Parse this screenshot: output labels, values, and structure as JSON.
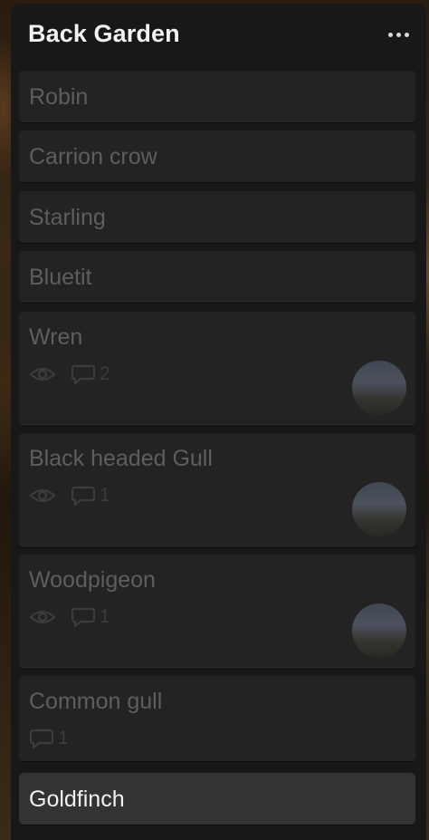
{
  "list": {
    "title": "Back Garden",
    "menu_icon": "more-horizontal-icon"
  },
  "cards": [
    {
      "title": "Robin"
    },
    {
      "title": "Carrion crow"
    },
    {
      "title": "Starling"
    },
    {
      "title": "Bluetit"
    },
    {
      "title": "Wren",
      "watching": true,
      "comments": "2",
      "has_avatar": true
    },
    {
      "title": "Black headed Gull",
      "watching": true,
      "comments": "1",
      "has_avatar": true
    },
    {
      "title": "Woodpigeon",
      "watching": true,
      "comments": "1",
      "has_avatar": true
    },
    {
      "title": "Common gull",
      "watching": false,
      "comments": "1",
      "has_avatar": false
    },
    {
      "title": "Goldfinch",
      "selected": true
    }
  ],
  "colors": {
    "list_bg": "#181818",
    "card_bg": "#232323",
    "card_text_dim": "#5e5e5e",
    "selected_card_bg": "#333333",
    "selected_text": "#f0f0f0"
  }
}
